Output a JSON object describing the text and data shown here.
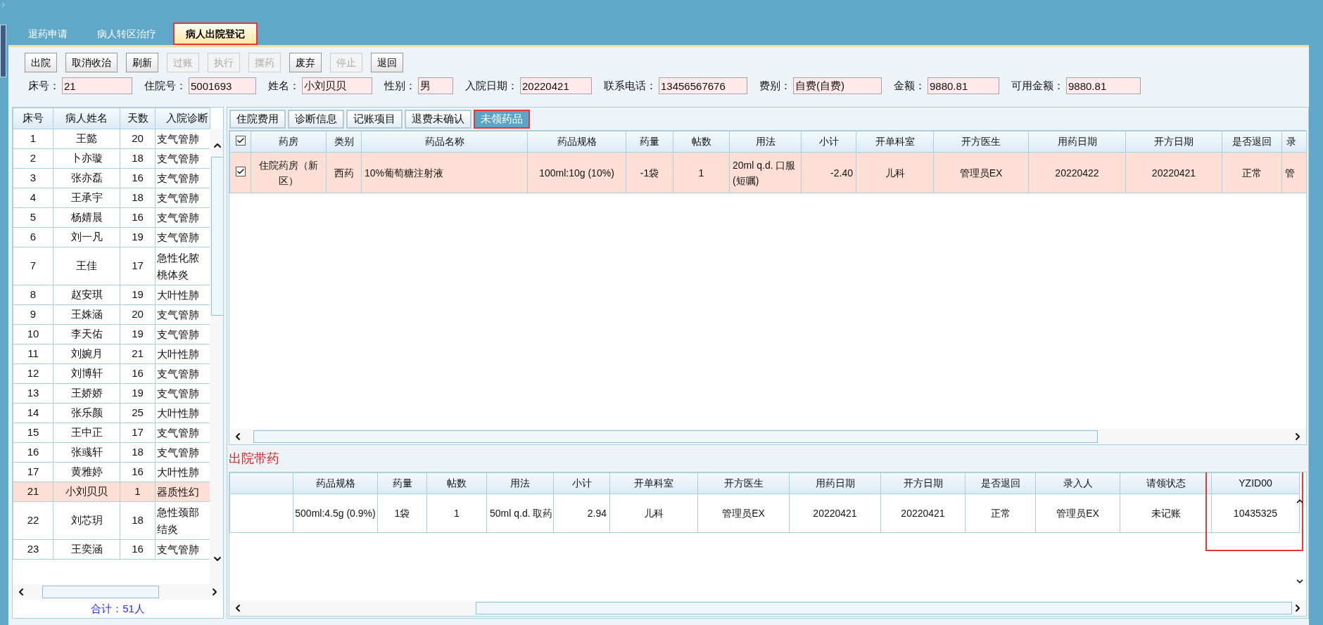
{
  "outer_tabs": [
    {
      "label": "退药申请",
      "selected": false,
      "highlighted": false
    },
    {
      "label": "病人转区治疗",
      "selected": false,
      "highlighted": false
    },
    {
      "label": "病人出院登记",
      "selected": true,
      "highlighted": true
    }
  ],
  "toolbar": [
    {
      "label": "出院",
      "disabled": false
    },
    {
      "label": "取消收治",
      "disabled": false
    },
    {
      "label": "刷新",
      "disabled": false
    },
    {
      "label": "过账",
      "disabled": true
    },
    {
      "label": "执行",
      "disabled": true
    },
    {
      "label": "摆药",
      "disabled": true
    },
    {
      "label": "废弃",
      "disabled": false
    },
    {
      "label": "停止",
      "disabled": true
    },
    {
      "label": "退回",
      "disabled": false
    }
  ],
  "patient_fields": [
    {
      "label": "床号：",
      "value": "21"
    },
    {
      "label": "住院号：",
      "value": "5001693"
    },
    {
      "label": "姓名：",
      "value": "小刘贝贝"
    },
    {
      "label": "性别：",
      "value": "男"
    },
    {
      "label": "入院日期：",
      "value": "20220421"
    },
    {
      "label": "联系电话：",
      "value": "13456567676"
    },
    {
      "label": "费别：",
      "value": "自费(自费)"
    },
    {
      "label": "金额：",
      "value": "9880.81"
    },
    {
      "label": "可用金额：",
      "value": "9880.81"
    }
  ],
  "patient_list": {
    "columns": [
      "床号",
      "病人姓名",
      "天数",
      "入院诊断"
    ],
    "rows": [
      {
        "bed": "1",
        "name": "王懿",
        "days": "20",
        "diagnosis": "支气管肺",
        "selected": false
      },
      {
        "bed": "2",
        "name": "卜亦璇",
        "days": "18",
        "diagnosis": "支气管肺",
        "selected": false
      },
      {
        "bed": "3",
        "name": "张亦磊",
        "days": "16",
        "diagnosis": "支气管肺",
        "selected": false
      },
      {
        "bed": "4",
        "name": "王承宇",
        "days": "18",
        "diagnosis": "支气管肺",
        "selected": false
      },
      {
        "bed": "5",
        "name": "杨婧晨",
        "days": "16",
        "diagnosis": "支气管肺",
        "selected": false
      },
      {
        "bed": "6",
        "name": "刘一凡",
        "days": "19",
        "diagnosis": "支气管肺",
        "selected": false
      },
      {
        "bed": "7",
        "name": "王佳",
        "days": "17",
        "diagnosis": "急性化脓桃体炎",
        "selected": false
      },
      {
        "bed": "8",
        "name": "赵安琪",
        "days": "19",
        "diagnosis": "大叶性肺",
        "selected": false
      },
      {
        "bed": "9",
        "name": "王姝涵",
        "days": "20",
        "diagnosis": "支气管肺",
        "selected": false
      },
      {
        "bed": "10",
        "name": "李天佑",
        "days": "19",
        "diagnosis": "支气管肺",
        "selected": false
      },
      {
        "bed": "11",
        "name": "刘婉月",
        "days": "21",
        "diagnosis": "大叶性肺",
        "selected": false
      },
      {
        "bed": "12",
        "name": "刘博轩",
        "days": "16",
        "diagnosis": "支气管肺",
        "selected": false
      },
      {
        "bed": "13",
        "name": "王娇娇",
        "days": "19",
        "diagnosis": "支气管肺",
        "selected": false
      },
      {
        "bed": "14",
        "name": "张乐颜",
        "days": "25",
        "diagnosis": "大叶性肺",
        "selected": false
      },
      {
        "bed": "15",
        "name": "王中正",
        "days": "17",
        "diagnosis": "支气管肺",
        "selected": false
      },
      {
        "bed": "16",
        "name": "张彧轩",
        "days": "18",
        "diagnosis": "支气管肺",
        "selected": false
      },
      {
        "bed": "17",
        "name": "黄雅婷",
        "days": "16",
        "diagnosis": "大叶性肺",
        "selected": false
      },
      {
        "bed": "21",
        "name": "小刘贝贝",
        "days": "1",
        "diagnosis": "器质性幻",
        "selected": true
      },
      {
        "bed": "22",
        "name": "刘芯玥",
        "days": "18",
        "diagnosis": "急性颈部结炎",
        "selected": false
      },
      {
        "bed": "23",
        "name": "王奕涵",
        "days": "16",
        "diagnosis": "支气管肺",
        "selected": false
      }
    ],
    "total": "合计：51人"
  },
  "detail_tabs": [
    {
      "label": "住院费用",
      "selected": false,
      "highlighted": false
    },
    {
      "label": "诊断信息",
      "selected": false,
      "highlighted": false
    },
    {
      "label": "记账项目",
      "selected": false,
      "highlighted": false
    },
    {
      "label": "退费未确认",
      "selected": false,
      "highlighted": false
    },
    {
      "label": "未领药品",
      "selected": true,
      "highlighted": true
    }
  ],
  "pending_grid": {
    "header_checked": true,
    "columns": [
      "药房",
      "类别",
      "药品名称",
      "药品规格",
      "药量",
      "帖数",
      "用法",
      "小计",
      "开单科室",
      "开方医生",
      "用药日期",
      "开方日期",
      "是否退回",
      "录"
    ],
    "rows": [
      {
        "checked": true,
        "selected": true,
        "cells": [
          "住院药房（新区）",
          "西药",
          "10%葡萄糖注射液",
          "100ml:10g (10%)",
          "-1袋",
          "1",
          "20ml q.d. 口服(短嘱)",
          "-2.40",
          "儿科",
          "管理员EX",
          "20220422",
          "20220421",
          "正常",
          "管"
        ]
      }
    ]
  },
  "discharge_section": {
    "title": "出院带药",
    "columns": [
      {
        "label": "药品规格",
        "highlighted": false
      },
      {
        "label": "药量",
        "highlighted": false
      },
      {
        "label": "帖数",
        "highlighted": false
      },
      {
        "label": "用法",
        "highlighted": false
      },
      {
        "label": "小计",
        "highlighted": false
      },
      {
        "label": "开单科室",
        "highlighted": false
      },
      {
        "label": "开方医生",
        "highlighted": false
      },
      {
        "label": "用药日期",
        "highlighted": false
      },
      {
        "label": "开方日期",
        "highlighted": false
      },
      {
        "label": "是否退回",
        "highlighted": false
      },
      {
        "label": "录入人",
        "highlighted": false
      },
      {
        "label": "请领状态",
        "highlighted": false
      },
      {
        "label": "YZID00",
        "highlighted": true
      }
    ],
    "rows": [
      {
        "cells": [
          "500ml:4.5g (0.9%)",
          "1袋",
          "1",
          "50ml q.d. 取药",
          "2.94",
          "儿科",
          "管理员EX",
          "20220421",
          "20220421",
          "正常",
          "管理员EX",
          "未记账",
          "10435325"
        ]
      }
    ]
  }
}
